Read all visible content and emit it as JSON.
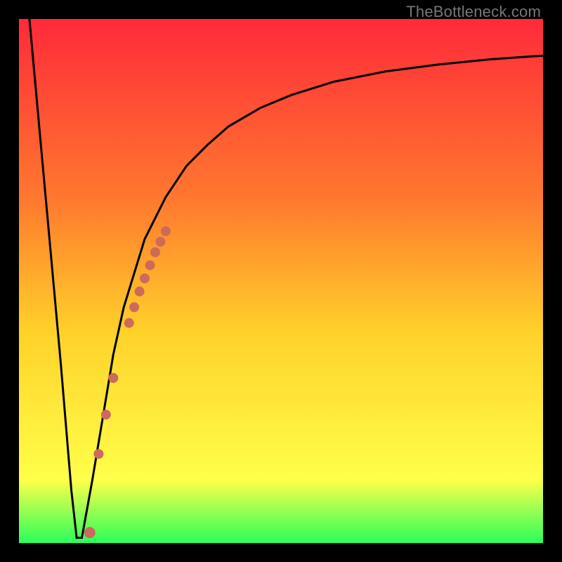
{
  "watermark": "TheBottleneck.com",
  "colors": {
    "frame": "#000000",
    "gradient_top": "#ff2a3a",
    "gradient_mid1": "#ff7a2e",
    "gradient_mid2": "#ffd22a",
    "gradient_mid3": "#ffff4a",
    "gradient_bottom": "#2aff5a",
    "curve": "#000000",
    "dots": "#cc6a5c"
  },
  "chart_data": {
    "type": "line",
    "title": "",
    "xlabel": "",
    "ylabel": "",
    "xlim": [
      0,
      100
    ],
    "ylim": [
      0,
      100
    ],
    "series": [
      {
        "name": "curve",
        "x": [
          2,
          4,
          6,
          8,
          10,
          11,
          12,
          14,
          16,
          18,
          20,
          24,
          28,
          32,
          36,
          40,
          46,
          52,
          60,
          70,
          80,
          90,
          100
        ],
        "values": [
          100,
          78,
          56,
          34,
          10,
          1,
          1,
          12,
          24,
          36,
          45,
          58,
          66,
          72,
          76,
          79.5,
          83,
          85.5,
          88,
          90,
          91.3,
          92.3,
          93
        ]
      }
    ],
    "dots": {
      "name": "highlight-dots",
      "x": [
        13.5,
        15.2,
        16.6,
        18.0,
        21.0,
        22.0,
        23.0,
        24.0,
        25.0,
        26.0,
        27.0,
        28.0
      ],
      "values": [
        2.0,
        17.0,
        24.5,
        31.5,
        42.0,
        45.0,
        48.0,
        50.5,
        53.0,
        55.5,
        57.5,
        59.5
      ]
    }
  }
}
